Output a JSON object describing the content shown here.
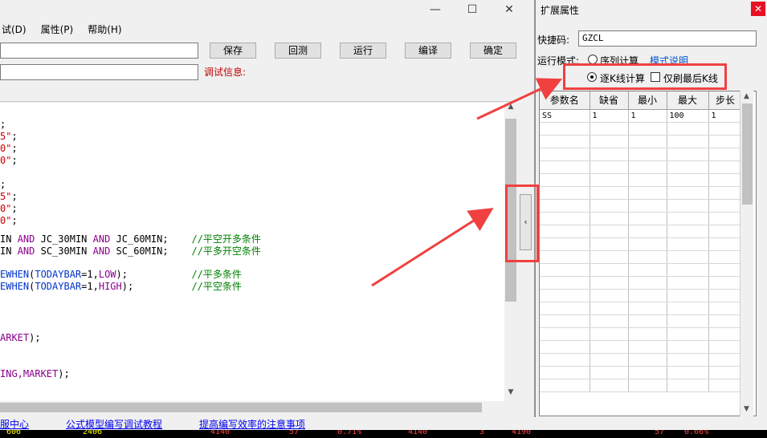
{
  "editor": {
    "window_controls": [
      "—",
      "☐",
      "✕"
    ],
    "menu": [
      "试(D)",
      "属性(P)",
      "帮助(H)"
    ],
    "buttons": {
      "save": "保存",
      "rollback": "回测",
      "run": "运行",
      "compile": "编译",
      "confirm": "确定"
    },
    "debug_label": "调试信息:",
    "code_lines": [
      {
        "segments": [
          {
            "t": "",
            "c": "c-def"
          },
          {
            "t": ";",
            "c": "c-def"
          }
        ]
      },
      {
        "segments": [
          {
            "t": "5\"",
            "c": "c-str"
          },
          {
            "t": ";",
            "c": "c-def"
          }
        ]
      },
      {
        "segments": [
          {
            "t": "0\"",
            "c": "c-str"
          },
          {
            "t": ";",
            "c": "c-def"
          }
        ]
      },
      {
        "segments": [
          {
            "t": "0\"",
            "c": "c-str"
          },
          {
            "t": ";",
            "c": "c-def"
          }
        ]
      },
      {
        "segments": [
          {
            "t": "",
            "c": "c-def"
          },
          {
            "t": ";",
            "c": "c-def"
          }
        ]
      },
      {
        "segments": [
          {
            "t": "5\"",
            "c": "c-str"
          },
          {
            "t": ";",
            "c": "c-def"
          }
        ]
      },
      {
        "segments": [
          {
            "t": "0\"",
            "c": "c-str"
          },
          {
            "t": ";",
            "c": "c-def"
          }
        ]
      },
      {
        "segments": [
          {
            "t": "0\"",
            "c": "c-str"
          },
          {
            "t": ";",
            "c": "c-def"
          }
        ]
      },
      {
        "segments": [
          {
            "t": "IN ",
            "c": "c-def"
          },
          {
            "t": "AND",
            "c": "c-kw"
          },
          {
            "t": " JC_30MIN ",
            "c": "c-def"
          },
          {
            "t": "AND",
            "c": "c-kw"
          },
          {
            "t": " JC_60MIN;    ",
            "c": "c-def"
          },
          {
            "t": "//平空开多条件",
            "c": "c-cm"
          }
        ]
      },
      {
        "segments": [
          {
            "t": "IN ",
            "c": "c-def"
          },
          {
            "t": "AND",
            "c": "c-kw"
          },
          {
            "t": " SC_30MIN ",
            "c": "c-def"
          },
          {
            "t": "AND",
            "c": "c-kw"
          },
          {
            "t": " SC_60MIN;    ",
            "c": "c-def"
          },
          {
            "t": "//平多开空条件",
            "c": "c-cm"
          }
        ]
      },
      {
        "segments": [
          {
            "t": "EWHEN",
            "c": "c-fn"
          },
          {
            "t": "(",
            "c": "c-def"
          },
          {
            "t": "TODAYBAR",
            "c": "c-fn"
          },
          {
            "t": "=1,",
            "c": "c-def"
          },
          {
            "t": "LOW",
            "c": "c-kw"
          },
          {
            "t": ");           ",
            "c": "c-def"
          },
          {
            "t": "//平多条件",
            "c": "c-cm"
          }
        ]
      },
      {
        "segments": [
          {
            "t": "EWHEN",
            "c": "c-fn"
          },
          {
            "t": "(",
            "c": "c-def"
          },
          {
            "t": "TODAYBAR",
            "c": "c-fn"
          },
          {
            "t": "=1,",
            "c": "c-def"
          },
          {
            "t": "HIGH",
            "c": "c-kw"
          },
          {
            "t": ");          ",
            "c": "c-def"
          },
          {
            "t": "//平空条件",
            "c": "c-cm"
          }
        ]
      },
      {
        "segments": [
          {
            "t": "ARKET",
            "c": "c-kw"
          },
          {
            "t": ");",
            "c": "c-def"
          }
        ]
      },
      {
        "segments": [
          {
            "t": "ING,",
            "c": "c-kw"
          },
          {
            "t": "MARKET",
            "c": "c-kw"
          },
          {
            "t": ");",
            "c": "c-def"
          }
        ]
      }
    ]
  },
  "bottom_links": [
    "服中心",
    "公式模型编写调试教程",
    "提高编写效率的注意事项"
  ],
  "status_values": [
    "606",
    "2406",
    "4140",
    "57",
    "0.71%",
    "4140",
    "3",
    "4190",
    "57",
    "0.66%"
  ],
  "props": {
    "title": "扩展属性",
    "close": "✕",
    "shortcut_label": "快捷码:",
    "shortcut_value": "GZCL",
    "mode_label": "运行模式:",
    "mode_seq": "序列计算",
    "mode_help": "模式说明",
    "mode_tick": "逐K线计算",
    "only_last_label": "仅刷最后K线",
    "mode_tick_checked": true,
    "only_last_checked": false,
    "table": {
      "headers": [
        "参数名",
        "缺省",
        "最小",
        "最大",
        "步长"
      ],
      "rows": [
        [
          "SS",
          "1",
          "1",
          "100",
          "1"
        ]
      ],
      "empty_rows": 21
    }
  },
  "colors": {
    "highlight_red": "#f04040",
    "link_blue": "#0000ee",
    "debug_red": "#c00000"
  }
}
